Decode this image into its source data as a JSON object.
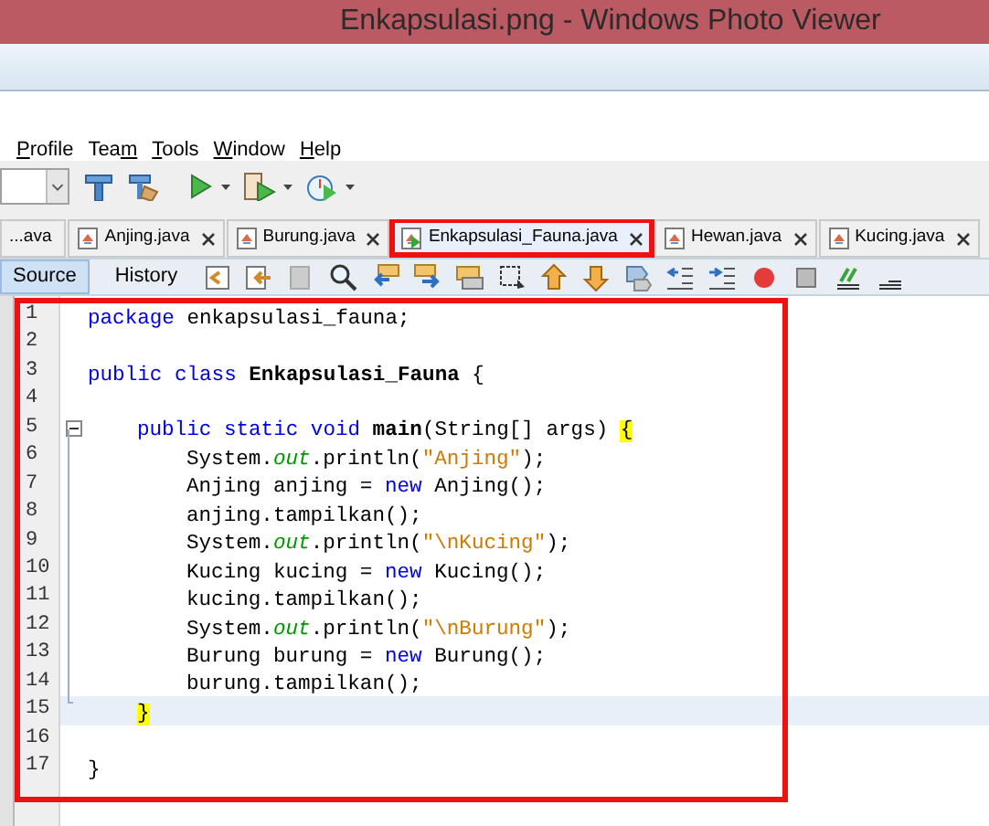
{
  "window": {
    "title": "Enkapsulasi.png - Windows Photo Viewer"
  },
  "menu": [
    {
      "key": "P",
      "after": "rofile"
    },
    {
      "before": "Tea",
      "key": "m"
    },
    {
      "key": "T",
      "after": "ools"
    },
    {
      "key": "W",
      "after": "indow"
    },
    {
      "key": "H",
      "after": "elp"
    }
  ],
  "tabs": [
    {
      "label": "...ava",
      "selected": false,
      "icon": false,
      "closable": false
    },
    {
      "label": "Anjing.java",
      "selected": false,
      "icon": true,
      "closable": true
    },
    {
      "label": "Burung.java",
      "selected": false,
      "icon": true,
      "closable": true
    },
    {
      "label": "Enkapsulasi_Fauna.java",
      "selected": true,
      "icon": true,
      "closable": true
    },
    {
      "label": "Hewan.java",
      "selected": false,
      "icon": true,
      "closable": true
    },
    {
      "label": "Kucing.java",
      "selected": false,
      "icon": true,
      "closable": true
    }
  ],
  "views": [
    {
      "label": "Source",
      "selected": true
    },
    {
      "label": "History",
      "selected": false
    }
  ],
  "editor": {
    "lines": [
      {
        "number": "1",
        "current": false,
        "fold": false,
        "kind": "top",
        "tokens": [
          {
            "text": "package",
            "kind": "keyword"
          },
          {
            "text": " enkapsulasi_fauna;",
            "kind": "plain"
          }
        ]
      },
      {
        "number": "2",
        "current": false,
        "fold": false
      },
      {
        "number": "3",
        "current": false,
        "fold": false,
        "kind": "top",
        "tokens": [
          {
            "text": "public class",
            "kind": "keyword"
          },
          {
            "text": " Enkapsulasi_Fauna",
            "kind": "bold"
          },
          {
            "text": " {",
            "kind": "plain"
          }
        ]
      },
      {
        "number": "4",
        "current": false,
        "fold": false
      },
      {
        "number": "5",
        "current": false,
        "fold": true,
        "kind": "method",
        "tokens": [
          {
            "text": "public static void",
            "kind": "keyword"
          },
          {
            "text": " main",
            "kind": "bold"
          },
          {
            "text": "(String[] args) ",
            "kind": "plain"
          },
          {
            "text": "{",
            "kind": "match"
          }
        ]
      },
      {
        "number": "6",
        "current": false,
        "fold": false,
        "kind": "body",
        "tokens": [
          {
            "text": "System.",
            "kind": "plain"
          },
          {
            "text": "out",
            "kind": "field"
          },
          {
            "text": ".println(",
            "kind": "plain"
          },
          {
            "text": "\"Anjing\"",
            "kind": "string"
          },
          {
            "text": ");",
            "kind": "plain"
          }
        ]
      },
      {
        "number": "7",
        "current": false,
        "fold": false,
        "kind": "body",
        "tokens": [
          {
            "text": "Anjing anjing = ",
            "kind": "plain"
          },
          {
            "text": "new",
            "kind": "keyword"
          },
          {
            "text": " Anjing();",
            "kind": "plain"
          }
        ]
      },
      {
        "number": "8",
        "current": false,
        "fold": false,
        "kind": "body",
        "tokens": [
          {
            "text": "anjing.tampilkan();",
            "kind": "plain"
          }
        ]
      },
      {
        "number": "9",
        "current": false,
        "fold": false,
        "kind": "body",
        "tokens": [
          {
            "text": "System.",
            "kind": "plain"
          },
          {
            "text": "out",
            "kind": "field"
          },
          {
            "text": ".println(",
            "kind": "plain"
          },
          {
            "text": "\"\\nKucing\"",
            "kind": "string"
          },
          {
            "text": ");",
            "kind": "plain"
          }
        ]
      },
      {
        "number": "10",
        "current": false,
        "fold": false,
        "kind": "body",
        "tokens": [
          {
            "text": "Kucing kucing = ",
            "kind": "plain"
          },
          {
            "text": "new",
            "kind": "keyword"
          },
          {
            "text": " Kucing();",
            "kind": "plain"
          }
        ]
      },
      {
        "number": "11",
        "current": false,
        "fold": false,
        "kind": "body",
        "tokens": [
          {
            "text": "kucing.tampilkan();",
            "kind": "plain"
          }
        ]
      },
      {
        "number": "12",
        "current": false,
        "fold": false,
        "kind": "body",
        "tokens": [
          {
            "text": "System.",
            "kind": "plain"
          },
          {
            "text": "out",
            "kind": "field"
          },
          {
            "text": ".println(",
            "kind": "plain"
          },
          {
            "text": "\"\\nBurung\"",
            "kind": "string"
          },
          {
            "text": ");",
            "kind": "plain"
          }
        ]
      },
      {
        "number": "13",
        "current": false,
        "fold": false,
        "kind": "body",
        "tokens": [
          {
            "text": "Burung burung = ",
            "kind": "plain"
          },
          {
            "text": "new",
            "kind": "keyword"
          },
          {
            "text": " Burung();",
            "kind": "plain"
          }
        ]
      },
      {
        "number": "14",
        "current": false,
        "fold": false,
        "kind": "body",
        "tokens": [
          {
            "text": "burung.tampilkan();",
            "kind": "plain"
          }
        ]
      },
      {
        "number": "15",
        "current": true,
        "fold": false,
        "kind": "method",
        "tokens": [
          {
            "text": "}",
            "kind": "match"
          }
        ]
      },
      {
        "number": "16",
        "current": false,
        "fold": false
      },
      {
        "number": "17",
        "current": false,
        "fold": false,
        "kind": "top",
        "tokens": [
          {
            "text": "}",
            "kind": "plain"
          }
        ]
      }
    ]
  }
}
